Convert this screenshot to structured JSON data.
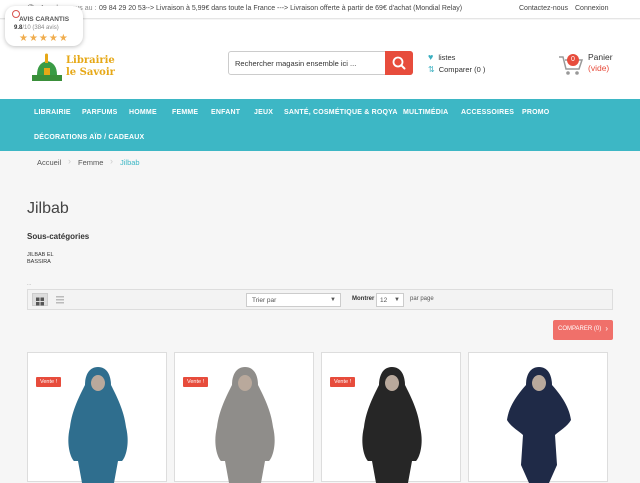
{
  "topbar": {
    "call_label": "Appelez-nous au :",
    "phone": "09 84 29 20 53",
    "shipping": "---> Livraison à 5,99€ dans toute la France ---> Livraison offerte à partir de 69€ d'achat (Mondial Relay)",
    "contact": "Contactez-nous",
    "login": "Connexion"
  },
  "review_badge": {
    "title": "AVIS CARANTIS",
    "score": "9.8",
    "score_suffix": "/10",
    "count": "(384 avis)",
    "stars": "★★★★★"
  },
  "header": {
    "logo_line1": "Librairie",
    "logo_line2": "le Savoir",
    "search_placeholder": "Rechercher magasin ensemble ici ...",
    "wishlist": "listes",
    "compare": "Comparer (0 )",
    "cart_count": "0",
    "cart_label": "Panier",
    "cart_empty": "(vide)"
  },
  "nav": {
    "items": [
      "LIBRAIRIE",
      "PARFUMS",
      "HOMME",
      "FEMME",
      "ENFANT",
      "JEUX",
      "SANTÉ, COSMÉTIQUE & ROQYA",
      "MULTIMÉDIA",
      "ACCESSOIRES",
      "PROMO",
      "DÉCORATIONS AÏD / CADEAUX"
    ]
  },
  "breadcrumb": {
    "home": "Accueil",
    "parent": "Femme",
    "current": "Jilbab"
  },
  "page": {
    "title": "Jilbab",
    "subcategories_heading": "Sous-catégories",
    "subcategories": [
      "JILBAB EL",
      "BASSIRA"
    ],
    "small_mark": "..."
  },
  "toolbar": {
    "sort_value": "Trier par",
    "show_label": "Montrer",
    "show_value": "12",
    "per_page": "par page"
  },
  "compare_button": "COMPARER (0)",
  "products": [
    {
      "sale_label": "Vente !",
      "has_sale": true,
      "color": "#2f6e8e"
    },
    {
      "sale_label": "Vente !",
      "has_sale": true,
      "color": "#8f8d8a"
    },
    {
      "sale_label": "Vente !",
      "has_sale": true,
      "color": "#262626"
    },
    {
      "sale_label": "",
      "has_sale": false,
      "color": "#1f2a47"
    }
  ],
  "colors": {
    "accent": "#3db7c5",
    "sale": "#e74c3c",
    "logo_gold": "#e6a817"
  }
}
